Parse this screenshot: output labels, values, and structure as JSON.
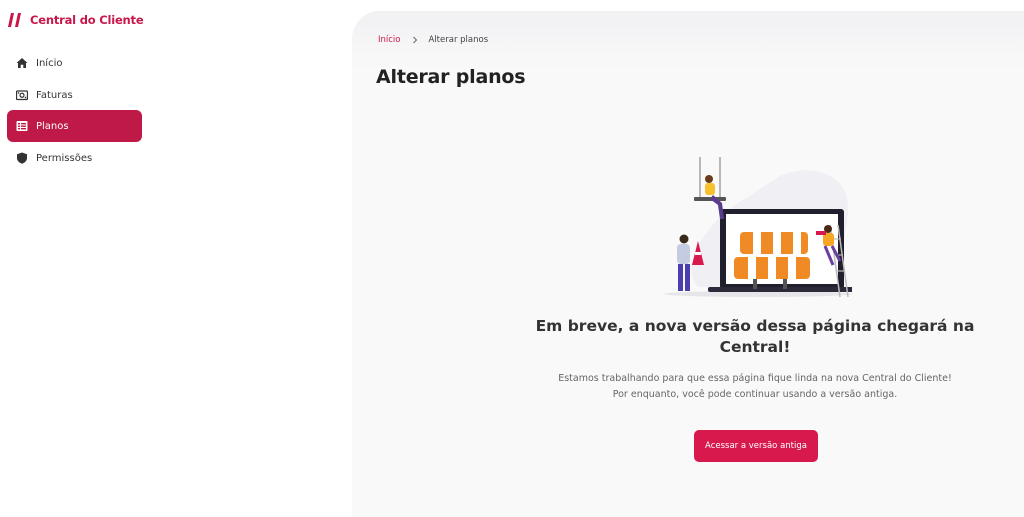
{
  "brand": {
    "name": "Central do Cliente",
    "color": "#c8174a"
  },
  "sidebar": {
    "items": [
      {
        "label": "Início",
        "icon": "home-icon"
      },
      {
        "label": "Faturas",
        "icon": "invoice-icon"
      },
      {
        "label": "Planos",
        "icon": "plans-icon",
        "active": true
      },
      {
        "label": "Permissões",
        "icon": "shield-icon"
      }
    ],
    "active_color": "#bf1a47"
  },
  "breadcrumb": {
    "home": "Início",
    "current": "Alterar planos"
  },
  "page": {
    "title": "Alterar planos",
    "headline": "Em breve, a nova versão dessa página chegará na Central!",
    "description_line1": "Estamos trabalhando para que essa página fique linda na nova Central do Cliente!",
    "description_line2": "Por enquanto, você pode continuar usando a versão antiga.",
    "cta_label": "Acessar a versão antiga",
    "illustration": "under-construction-illustration"
  },
  "colors": {
    "accent": "#d7194e",
    "background": "#f9f9fa"
  }
}
